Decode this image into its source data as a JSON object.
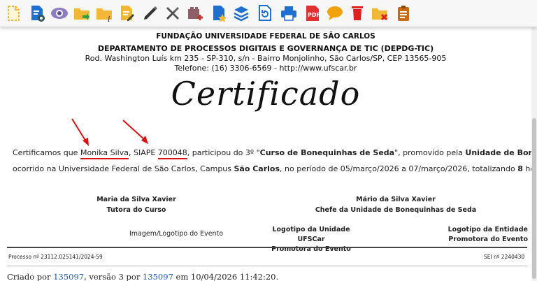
{
  "toolbar": {
    "icons": [
      "new-document-icon",
      "document-settings-icon",
      "view-icon",
      "folder-move-icon",
      "folder-info-icon",
      "edit-document-icon",
      "sign-pen-icon",
      "tools-icon",
      "add-block-icon",
      "favorite-document-icon",
      "layers-icon",
      "reload-icon",
      "print-icon",
      "pdf-icon",
      "comment-icon",
      "delete-icon",
      "folder-remove-icon",
      "checklist-icon"
    ]
  },
  "header": {
    "institution": "FUNDAÇÃO UNIVERSIDADE FEDERAL DE SÃO CARLOS",
    "department": "DEPARTAMENTO DE PROCESSOS DIGITAIS E GOVERNANÇA DE TIC (DEPDG-TIC)",
    "address": "Rod. Washington Luís km 235 - SP-310, s/n - Bairro Monjolinho, São Carlos/SP, CEP 13565-905",
    "phone": "Telefone: (16) 3306-6569 - http://www.ufscar.br"
  },
  "certificate": {
    "title": "Certificado",
    "p1_a": "Certificamos que ",
    "name": "Monika Silva",
    "p1_b": ", SIAPE ",
    "siape": "700048",
    "p1_c": ", participou do 3º \"",
    "course": "Curso de Bonequinhas de Seda",
    "p1_d": "\", promovido pela ",
    "unit": "Unidade de Bonequinhas de Seda",
    "p1_e": ",",
    "p2_a": "ocorrido na Universidade Federal de São Carlos, Campus ",
    "campus": "São Carlos",
    "p2_b": ", no período de 05/março/2026 a 07/março/2026, totalizando ",
    "hours": "8",
    "p2_c": " horas-aula ."
  },
  "signatures": {
    "left_name": "Maria da Silva Xavier",
    "left_role": "Tutora do Curso",
    "right_name": "Mário da Silva Xavier",
    "right_role": "Chefe da Unidade de Bonequinhas de Seda"
  },
  "logos": {
    "event": "Imagem/Logotipo do Evento",
    "unit_line1": "Logotipo da Unidade UFSCar",
    "unit_line2": "Promotora do Evento",
    "entity_line1": "Logotipo da Entidade",
    "entity_line2": "Promotora do Evento"
  },
  "document_meta": {
    "process": "Processo nº 23112.025141/2024-59",
    "sei": "SEI nº 2240430"
  },
  "footer": {
    "a": "Criado por ",
    "creator": "135097",
    "b": ", versão 3 por ",
    "editor": "135097",
    "c": " em 10/04/2026 11:42:20."
  },
  "colors": {
    "annotation_red": "#dd1111",
    "link_blue": "#1a5fb4",
    "folder_yellow": "#f2b735",
    "primary_blue": "#1f6fd1"
  }
}
